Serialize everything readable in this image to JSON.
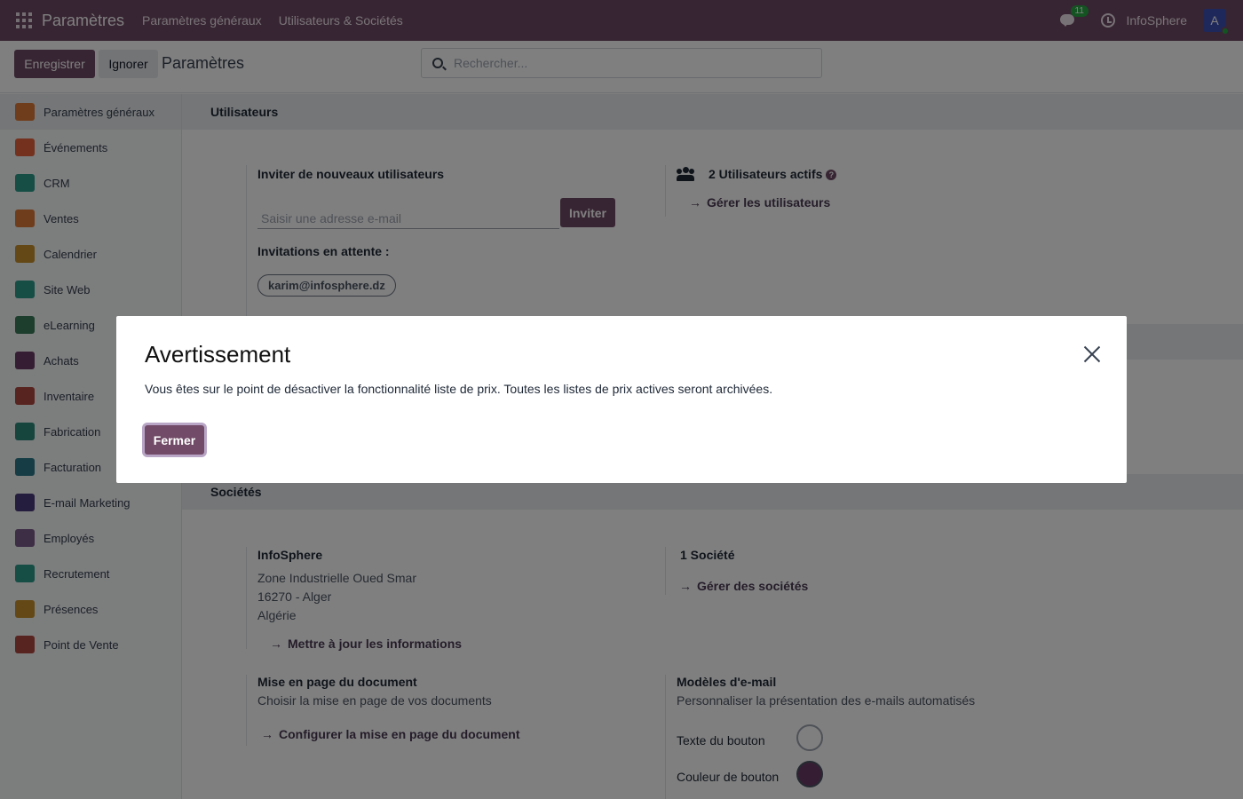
{
  "navbar": {
    "app_title": "Paramètres",
    "menus": [
      "Paramètres généraux",
      "Utilisateurs & Sociétés"
    ],
    "messages_badge": "11",
    "company": "InfoSphere",
    "avatar_letter": "A",
    "bg_color": "#714b67"
  },
  "control_panel": {
    "save_label": "Enregistrer",
    "discard_label": "Ignorer",
    "breadcrumb": "Paramètres",
    "search_placeholder": "Rechercher..."
  },
  "sidebar": {
    "items": [
      {
        "label": "Paramètres généraux",
        "icon": "settings-app-icon",
        "color": "#e07b39",
        "active": true
      },
      {
        "label": "Événements",
        "icon": "events-app-icon",
        "color": "#e8623c"
      },
      {
        "label": "CRM",
        "icon": "crm-app-icon",
        "color": "#2c9c8d"
      },
      {
        "label": "Ventes",
        "icon": "sales-app-icon",
        "color": "#e07b39"
      },
      {
        "label": "Calendrier",
        "icon": "calendar-app-icon",
        "color": "#c9922f"
      },
      {
        "label": "Site Web",
        "icon": "website-app-icon",
        "color": "#2c9c8d"
      },
      {
        "label": "eLearning",
        "icon": "elearning-app-icon",
        "color": "#3a7d5a"
      },
      {
        "label": "Achats",
        "icon": "purchase-app-icon",
        "color": "#6b3d66"
      },
      {
        "label": "Inventaire",
        "icon": "inventory-app-icon",
        "color": "#b0493e"
      },
      {
        "label": "Fabrication",
        "icon": "manufacturing-app-icon",
        "color": "#2c8a7a"
      },
      {
        "label": "Facturation",
        "icon": "invoicing-app-icon",
        "color": "#2c7a8a"
      },
      {
        "label": "E-mail Marketing",
        "icon": "email-marketing-app-icon",
        "color": "#4a3a7a"
      },
      {
        "label": "Employés",
        "icon": "employees-app-icon",
        "color": "#7a5a8a"
      },
      {
        "label": "Recrutement",
        "icon": "recruitment-app-icon",
        "color": "#2c9c8d"
      },
      {
        "label": "Présences",
        "icon": "attendances-app-icon",
        "color": "#c9922f"
      },
      {
        "label": "Point de Vente",
        "icon": "pos-app-icon",
        "color": "#b0493e"
      }
    ]
  },
  "users_section": {
    "title": "Utilisateurs",
    "invite_title": "Inviter de nouveaux utilisateurs",
    "email_placeholder": "Saisir une adresse e-mail",
    "invite_button": "Inviter",
    "pending_label": "Invitations en attente :",
    "pending_email": "karim@infosphere.dz",
    "active_users": "2 Utilisateurs actifs",
    "manage_users": "Gérer les utilisateurs"
  },
  "companies_section": {
    "title": "Sociétés",
    "company_name": "InfoSphere",
    "address_line1": "Zone Industrielle Oued Smar",
    "address_line2": "16270 - Alger",
    "address_line3": "Algérie",
    "update_info": "Mettre à jour les informations",
    "count_label": "1 Société",
    "manage_companies": "Gérer des sociétés",
    "doc_layout_title": "Mise en page du document",
    "doc_layout_desc": "Choisir la mise en page de vos documents",
    "doc_layout_link": "Configurer la mise en page du document",
    "email_templates_title": "Modèles d'e-mail",
    "email_templates_desc": "Personnaliser la présentation des e-mails automatisés",
    "button_text_label": "Texte du bouton",
    "button_color_label": "Couleur de bouton",
    "button_color_value": "#6b3d66"
  },
  "dialog": {
    "title": "Avertissement",
    "message": "Vous êtes sur le point de désactiver la fonctionnalité liste de prix. Toutes les listes de prix actives seront archivées.",
    "close_button": "Fermer"
  }
}
